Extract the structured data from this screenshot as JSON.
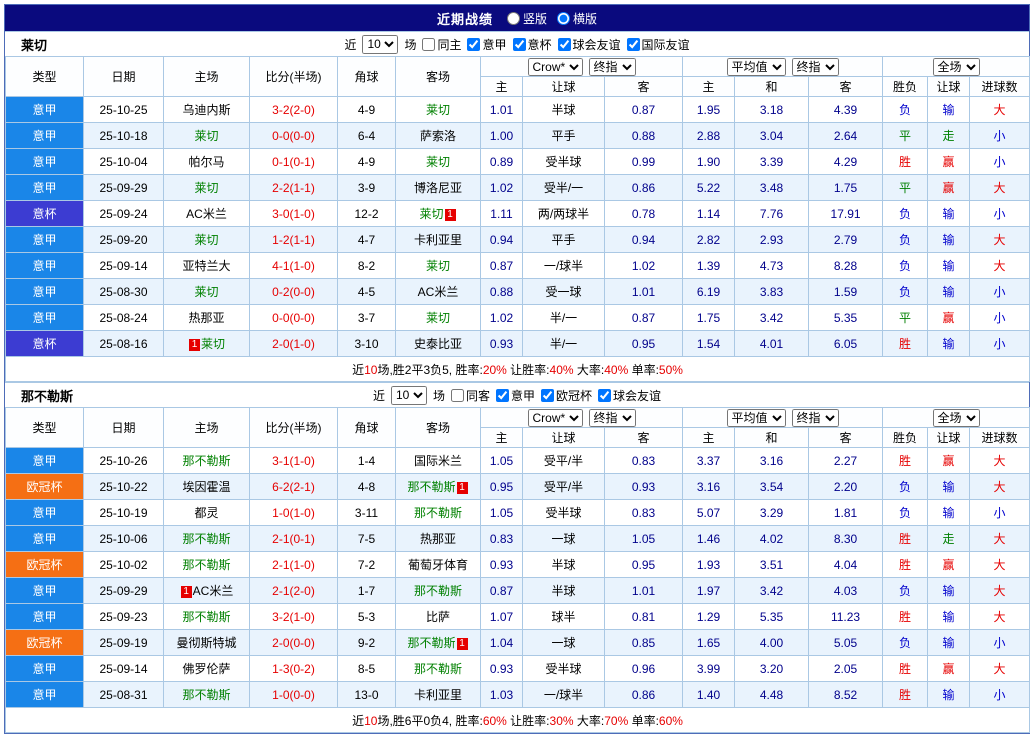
{
  "page": {
    "title": "近期战绩",
    "view_options": [
      {
        "label": "竖版",
        "selected": false
      },
      {
        "label": "横版",
        "selected": true
      }
    ]
  },
  "colors": {
    "topbar_bg": "#0a0a7e",
    "page_border": "#4e6cb8",
    "table_border": "#aac8e4",
    "row_alt_bg": "#e9f3fd",
    "score": "#e60000",
    "odds": "#00008b",
    "focus_team": "#008000",
    "summary_highlight": "#e60000",
    "type": {
      "意甲": "#1a86e8",
      "意杯": "#3c3cd2",
      "欧冠杯": "#f56f14"
    },
    "result": {
      "胜": "#e60000",
      "平": "#008000",
      "负": "#0000cd",
      "赢": "#e60000",
      "走": "#008000",
      "输": "#0000cd",
      "大": "#e60000",
      "小": "#0000cd"
    }
  },
  "columns": {
    "main": [
      "类型",
      "日期",
      "主场",
      "比分(半场)",
      "角球",
      "客场"
    ],
    "odds_groups": [
      [
        "Crow*",
        "终指"
      ],
      [
        "平均值",
        "终指"
      ],
      [
        "全场"
      ]
    ],
    "sub": [
      "主",
      "让球",
      "客",
      "主",
      "和",
      "客",
      "胜负",
      "让球",
      "进球数"
    ]
  },
  "misc": {
    "card_text": "1"
  },
  "sections": [
    {
      "team": "莱切",
      "filters": {
        "recent_prefix": "近",
        "recent_value": "10",
        "recent_suffix": "场",
        "checkboxes": [
          {
            "label": "同主",
            "checked": false
          },
          {
            "label": "意甲",
            "checked": true
          },
          {
            "label": "意杯",
            "checked": true
          },
          {
            "label": "球会友谊",
            "checked": true
          },
          {
            "label": "国际友谊",
            "checked": true
          }
        ]
      },
      "rows": [
        {
          "type": "意甲",
          "date": "25-10-25",
          "home": {
            "name": "乌迪内斯",
            "focus": false,
            "card": null
          },
          "score": "3-2(2-0)",
          "corner": "4-9",
          "away": {
            "name": "莱切",
            "focus": true,
            "card": null
          },
          "odds": [
            "1.01",
            "半球",
            "0.87",
            "1.95",
            "3.18",
            "4.39"
          ],
          "results": [
            "负",
            "输",
            "大"
          ]
        },
        {
          "type": "意甲",
          "date": "25-10-18",
          "home": {
            "name": "莱切",
            "focus": true,
            "card": null
          },
          "score": "0-0(0-0)",
          "corner": "6-4",
          "away": {
            "name": "萨索洛",
            "focus": false,
            "card": null
          },
          "odds": [
            "1.00",
            "平手",
            "0.88",
            "2.88",
            "3.04",
            "2.64"
          ],
          "results": [
            "平",
            "走",
            "小"
          ]
        },
        {
          "type": "意甲",
          "date": "25-10-04",
          "home": {
            "name": "帕尔马",
            "focus": false,
            "card": null
          },
          "score": "0-1(0-1)",
          "corner": "4-9",
          "away": {
            "name": "莱切",
            "focus": true,
            "card": null
          },
          "odds": [
            "0.89",
            "受半球",
            "0.99",
            "1.90",
            "3.39",
            "4.29"
          ],
          "results": [
            "胜",
            "赢",
            "小"
          ]
        },
        {
          "type": "意甲",
          "date": "25-09-29",
          "home": {
            "name": "莱切",
            "focus": true,
            "card": null
          },
          "score": "2-2(1-1)",
          "corner": "3-9",
          "away": {
            "name": "博洛尼亚",
            "focus": false,
            "card": null
          },
          "odds": [
            "1.02",
            "受半/一",
            "0.86",
            "5.22",
            "3.48",
            "1.75"
          ],
          "results": [
            "平",
            "赢",
            "大"
          ]
        },
        {
          "type": "意杯",
          "date": "25-09-24",
          "home": {
            "name": "AC米兰",
            "focus": false,
            "card": null
          },
          "score": "3-0(1-0)",
          "corner": "12-2",
          "away": {
            "name": "莱切",
            "focus": true,
            "card": "after"
          },
          "odds": [
            "1.11",
            "两/两球半",
            "0.78",
            "1.14",
            "7.76",
            "17.91"
          ],
          "results": [
            "负",
            "输",
            "小"
          ]
        },
        {
          "type": "意甲",
          "date": "25-09-20",
          "home": {
            "name": "莱切",
            "focus": true,
            "card": null
          },
          "score": "1-2(1-1)",
          "corner": "4-7",
          "away": {
            "name": "卡利亚里",
            "focus": false,
            "card": null
          },
          "odds": [
            "0.94",
            "平手",
            "0.94",
            "2.82",
            "2.93",
            "2.79"
          ],
          "results": [
            "负",
            "输",
            "大"
          ]
        },
        {
          "type": "意甲",
          "date": "25-09-14",
          "home": {
            "name": "亚特兰大",
            "focus": false,
            "card": null
          },
          "score": "4-1(1-0)",
          "corner": "8-2",
          "away": {
            "name": "莱切",
            "focus": true,
            "card": null
          },
          "odds": [
            "0.87",
            "一/球半",
            "1.02",
            "1.39",
            "4.73",
            "8.28"
          ],
          "results": [
            "负",
            "输",
            "大"
          ]
        },
        {
          "type": "意甲",
          "date": "25-08-30",
          "home": {
            "name": "莱切",
            "focus": true,
            "card": null
          },
          "score": "0-2(0-0)",
          "corner": "4-5",
          "away": {
            "name": "AC米兰",
            "focus": false,
            "card": null
          },
          "odds": [
            "0.88",
            "受一球",
            "1.01",
            "6.19",
            "3.83",
            "1.59"
          ],
          "results": [
            "负",
            "输",
            "小"
          ]
        },
        {
          "type": "意甲",
          "date": "25-08-24",
          "home": {
            "name": "热那亚",
            "focus": false,
            "card": null
          },
          "score": "0-0(0-0)",
          "corner": "3-7",
          "away": {
            "name": "莱切",
            "focus": true,
            "card": null
          },
          "odds": [
            "1.02",
            "半/一",
            "0.87",
            "1.75",
            "3.42",
            "5.35"
          ],
          "results": [
            "平",
            "赢",
            "小"
          ]
        },
        {
          "type": "意杯",
          "date": "25-08-16",
          "home": {
            "name": "莱切",
            "focus": true,
            "card": "before"
          },
          "score": "2-0(1-0)",
          "corner": "3-10",
          "away": {
            "name": "史泰比亚",
            "focus": false,
            "card": null
          },
          "odds": [
            "0.93",
            "半/一",
            "0.95",
            "1.54",
            "4.01",
            "6.05"
          ],
          "results": [
            "胜",
            "输",
            "小"
          ]
        }
      ],
      "summary": [
        {
          "t": "近"
        },
        {
          "t": "10",
          "c": "#e60000"
        },
        {
          "t": "场,胜2平3负5, 胜率:"
        },
        {
          "t": "20%",
          "c": "#e60000"
        },
        {
          "t": " 让胜率:"
        },
        {
          "t": "40%",
          "c": "#e60000"
        },
        {
          "t": " 大率:"
        },
        {
          "t": "40%",
          "c": "#e60000"
        },
        {
          "t": " 单率:"
        },
        {
          "t": "50%",
          "c": "#e60000"
        }
      ]
    },
    {
      "team": "那不勒斯",
      "filters": {
        "recent_prefix": "近",
        "recent_value": "10",
        "recent_suffix": "场",
        "checkboxes": [
          {
            "label": "同客",
            "checked": false
          },
          {
            "label": "意甲",
            "checked": true
          },
          {
            "label": "欧冠杯",
            "checked": true
          },
          {
            "label": "球会友谊",
            "checked": true
          }
        ]
      },
      "rows": [
        {
          "type": "意甲",
          "date": "25-10-26",
          "home": {
            "name": "那不勒斯",
            "focus": true,
            "card": null
          },
          "score": "3-1(1-0)",
          "corner": "1-4",
          "away": {
            "name": "国际米兰",
            "focus": false,
            "card": null
          },
          "odds": [
            "1.05",
            "受平/半",
            "0.83",
            "3.37",
            "3.16",
            "2.27"
          ],
          "results": [
            "胜",
            "赢",
            "大"
          ]
        },
        {
          "type": "欧冠杯",
          "date": "25-10-22",
          "home": {
            "name": "埃因霍温",
            "focus": false,
            "card": null
          },
          "score": "6-2(2-1)",
          "corner": "4-8",
          "away": {
            "name": "那不勒斯",
            "focus": true,
            "card": "after"
          },
          "odds": [
            "0.95",
            "受平/半",
            "0.93",
            "3.16",
            "3.54",
            "2.20"
          ],
          "results": [
            "负",
            "输",
            "大"
          ]
        },
        {
          "type": "意甲",
          "date": "25-10-19",
          "home": {
            "name": "都灵",
            "focus": false,
            "card": null
          },
          "score": "1-0(1-0)",
          "corner": "3-11",
          "away": {
            "name": "那不勒斯",
            "focus": true,
            "card": null
          },
          "odds": [
            "1.05",
            "受半球",
            "0.83",
            "5.07",
            "3.29",
            "1.81"
          ],
          "results": [
            "负",
            "输",
            "小"
          ]
        },
        {
          "type": "意甲",
          "date": "25-10-06",
          "home": {
            "name": "那不勒斯",
            "focus": true,
            "card": null
          },
          "score": "2-1(0-1)",
          "corner": "7-5",
          "away": {
            "name": "热那亚",
            "focus": false,
            "card": null
          },
          "odds": [
            "0.83",
            "一球",
            "1.05",
            "1.46",
            "4.02",
            "8.30"
          ],
          "results": [
            "胜",
            "走",
            "大"
          ]
        },
        {
          "type": "欧冠杯",
          "date": "25-10-02",
          "home": {
            "name": "那不勒斯",
            "focus": true,
            "card": null
          },
          "score": "2-1(1-0)",
          "corner": "7-2",
          "away": {
            "name": "葡萄牙体育",
            "focus": false,
            "card": null
          },
          "odds": [
            "0.93",
            "半球",
            "0.95",
            "1.93",
            "3.51",
            "4.04"
          ],
          "results": [
            "胜",
            "赢",
            "大"
          ]
        },
        {
          "type": "意甲",
          "date": "25-09-29",
          "home": {
            "name": "AC米兰",
            "focus": false,
            "card": "before"
          },
          "score": "2-1(2-0)",
          "corner": "1-7",
          "away": {
            "name": "那不勒斯",
            "focus": true,
            "card": null
          },
          "odds": [
            "0.87",
            "半球",
            "1.01",
            "1.97",
            "3.42",
            "4.03"
          ],
          "results": [
            "负",
            "输",
            "大"
          ]
        },
        {
          "type": "意甲",
          "date": "25-09-23",
          "home": {
            "name": "那不勒斯",
            "focus": true,
            "card": null
          },
          "score": "3-2(1-0)",
          "corner": "5-3",
          "away": {
            "name": "比萨",
            "focus": false,
            "card": null
          },
          "odds": [
            "1.07",
            "球半",
            "0.81",
            "1.29",
            "5.35",
            "11.23"
          ],
          "results": [
            "胜",
            "输",
            "大"
          ]
        },
        {
          "type": "欧冠杯",
          "date": "25-09-19",
          "home": {
            "name": "曼彻斯特城",
            "focus": false,
            "card": null
          },
          "score": "2-0(0-0)",
          "corner": "9-2",
          "away": {
            "name": "那不勒斯",
            "focus": true,
            "card": "after"
          },
          "odds": [
            "1.04",
            "一球",
            "0.85",
            "1.65",
            "4.00",
            "5.05"
          ],
          "results": [
            "负",
            "输",
            "小"
          ]
        },
        {
          "type": "意甲",
          "date": "25-09-14",
          "home": {
            "name": "佛罗伦萨",
            "focus": false,
            "card": null
          },
          "score": "1-3(0-2)",
          "corner": "8-5",
          "away": {
            "name": "那不勒斯",
            "focus": true,
            "card": null
          },
          "odds": [
            "0.93",
            "受半球",
            "0.96",
            "3.99",
            "3.20",
            "2.05"
          ],
          "results": [
            "胜",
            "赢",
            "大"
          ]
        },
        {
          "type": "意甲",
          "date": "25-08-31",
          "home": {
            "name": "那不勒斯",
            "focus": true,
            "card": null
          },
          "score": "1-0(0-0)",
          "corner": "13-0",
          "away": {
            "name": "卡利亚里",
            "focus": false,
            "card": null
          },
          "odds": [
            "1.03",
            "一/球半",
            "0.86",
            "1.40",
            "4.48",
            "8.52"
          ],
          "results": [
            "胜",
            "输",
            "小"
          ]
        }
      ],
      "summary": [
        {
          "t": "近"
        },
        {
          "t": "10",
          "c": "#e60000"
        },
        {
          "t": "场,胜6平0负4, 胜率:"
        },
        {
          "t": "60%",
          "c": "#e60000"
        },
        {
          "t": " 让胜率:"
        },
        {
          "t": "30%",
          "c": "#e60000"
        },
        {
          "t": " 大率:"
        },
        {
          "t": "70%",
          "c": "#e60000"
        },
        {
          "t": " 单率:"
        },
        {
          "t": "60%",
          "c": "#e60000"
        }
      ]
    }
  ]
}
